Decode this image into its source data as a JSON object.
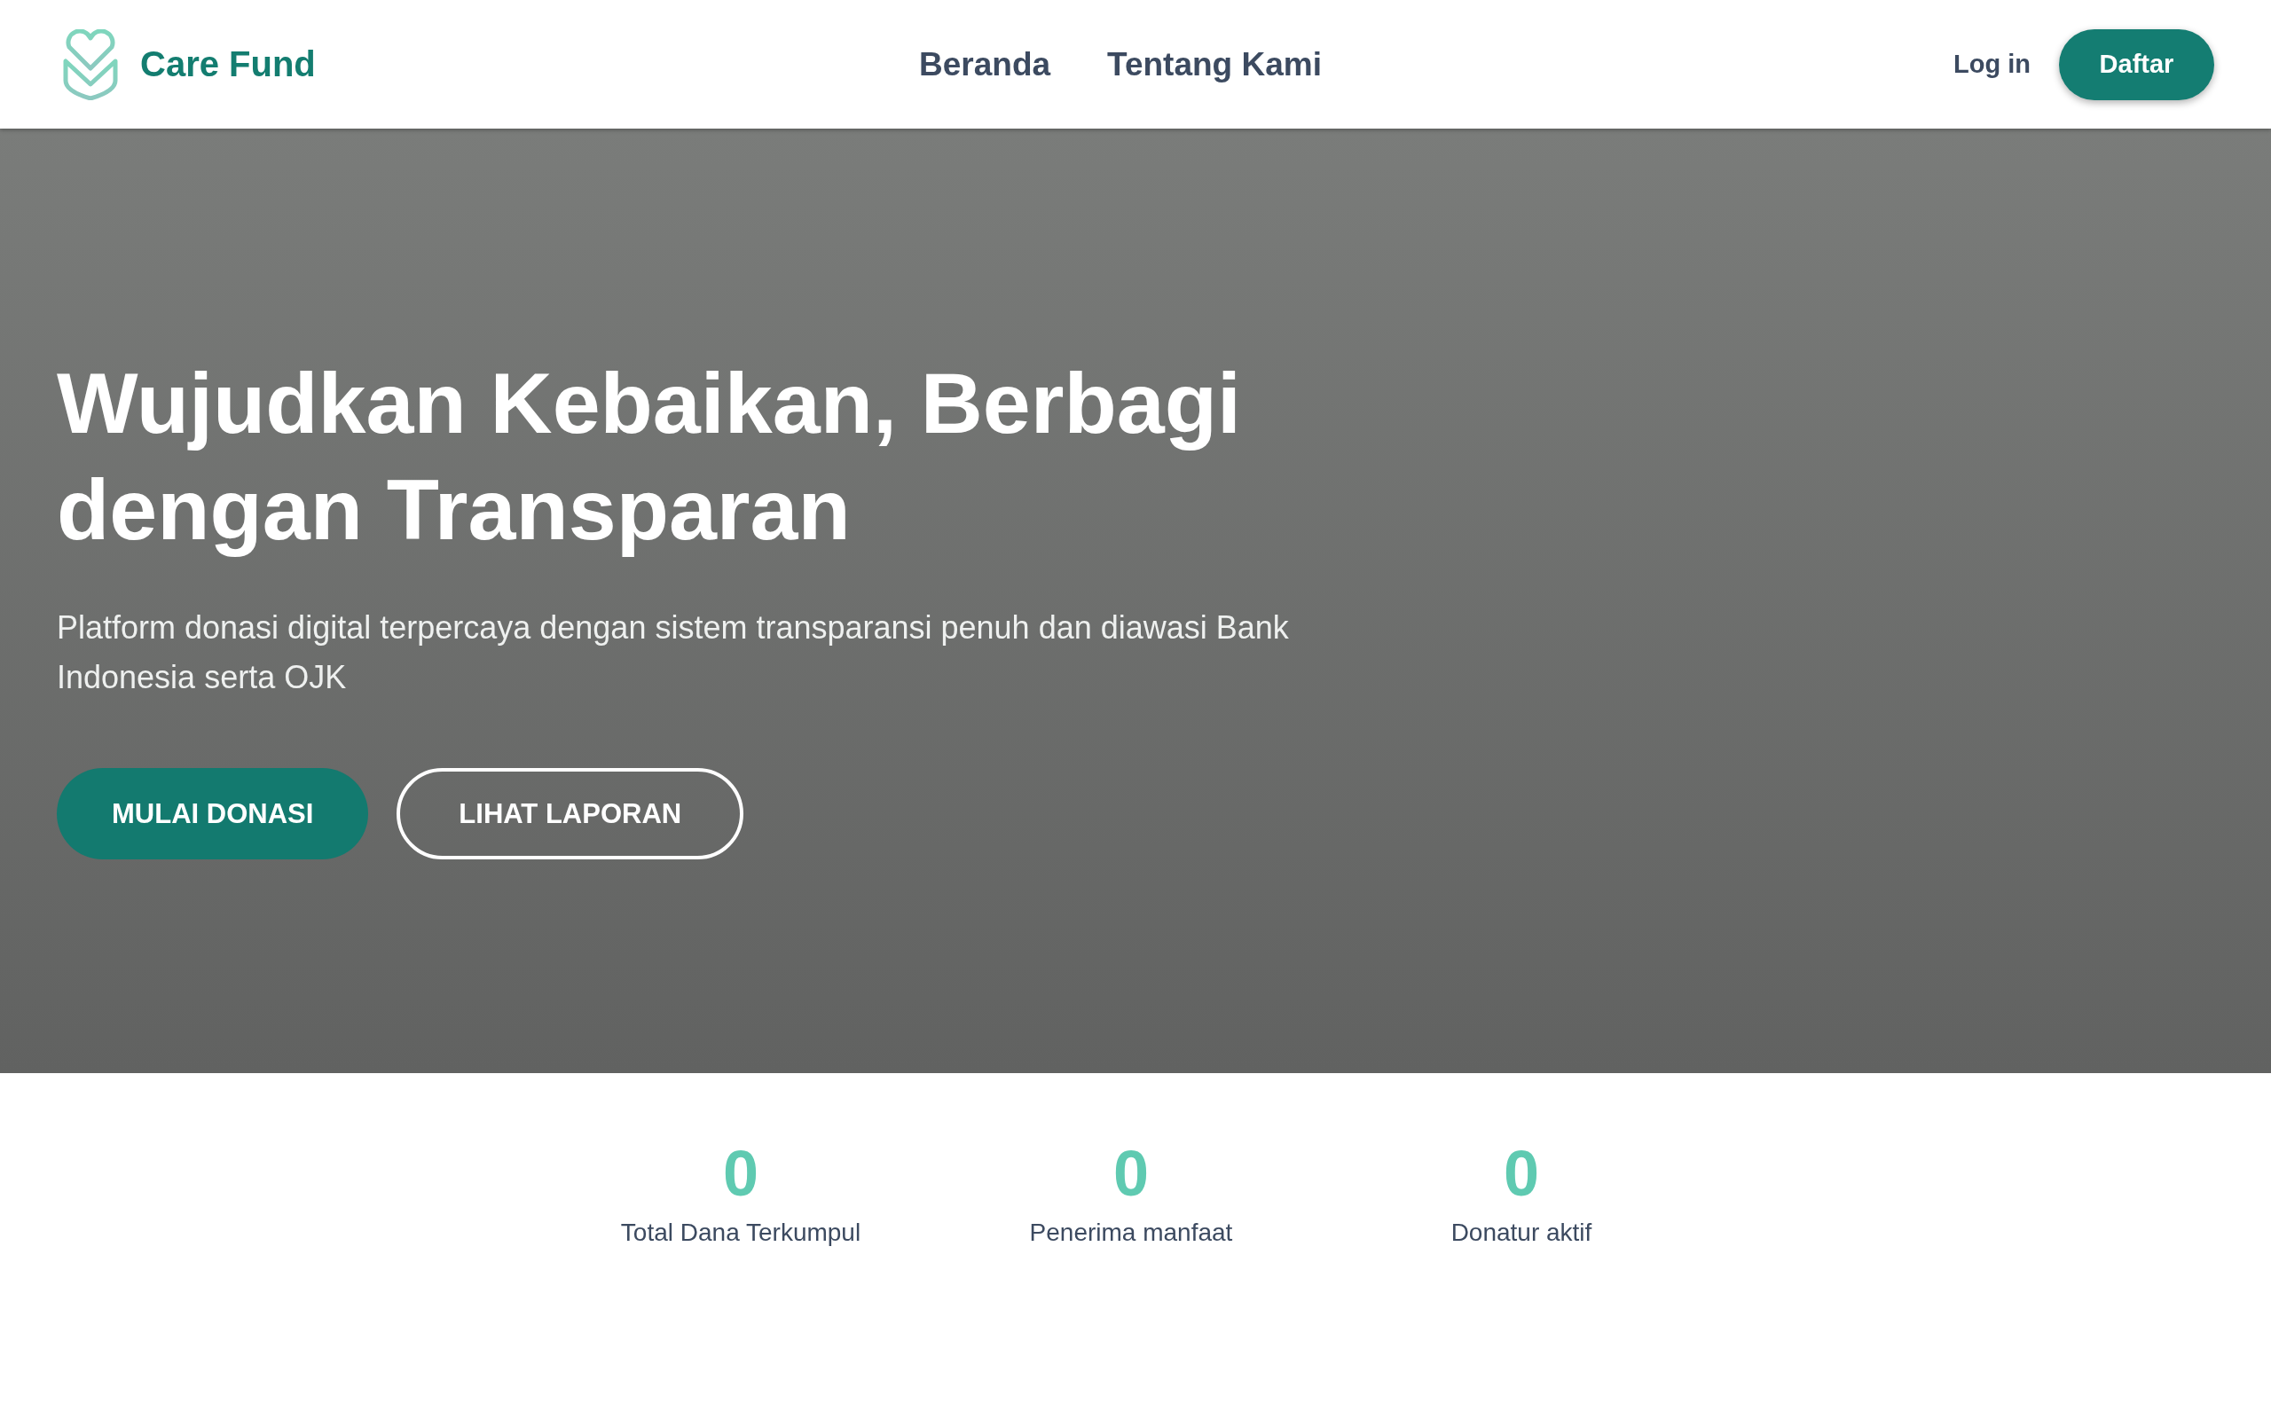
{
  "header": {
    "brand": "Care Fund",
    "nav": [
      "Beranda",
      "Tentang Kami"
    ],
    "login": "Log in",
    "register": "Daftar"
  },
  "hero": {
    "title_lines": [
      "Wujudkan Kebaikan, Berbagi",
      "dengan Transparan"
    ],
    "subtitle": "Platform donasi digital terpercaya dengan sistem transparansi penuh dan diawasi Bank Indonesia serta OJK",
    "buttons": [
      {
        "label": "MULAI DONASI",
        "kind": "primary"
      },
      {
        "label": "LIHAT LAPORAN",
        "kind": "outline"
      }
    ]
  },
  "stats": [
    {
      "value": "0",
      "label": "Total Dana Terkumpul"
    },
    {
      "value": "0",
      "label": "Penerima manfaat"
    },
    {
      "value": "0",
      "label": "Donatur aktif"
    }
  ]
}
